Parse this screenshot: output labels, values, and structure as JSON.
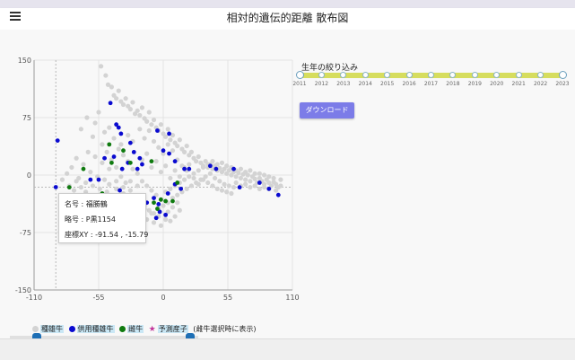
{
  "header": {
    "title": "相対的遺伝的距離 散布図"
  },
  "tooltip": {
    "name_line": "名号 : 福勝鶴",
    "code_line": "略号 : P黒1154",
    "coord_line": "座標XY : -91.54 , -15.79"
  },
  "filter": {
    "label": "生年の絞り込み",
    "years": [
      "2011",
      "2012",
      "2013",
      "2014",
      "2015",
      "2016",
      "2017",
      "2018",
      "2019",
      "2020",
      "2021",
      "2022",
      "2023"
    ],
    "selected_range": [
      "2011",
      "2023"
    ]
  },
  "download": {
    "label": "ダウンロード"
  },
  "legend": {
    "items": [
      {
        "label": "種雄牛",
        "marker": "dot",
        "color": "#d3d3d3"
      },
      {
        "label": "供用種雄牛",
        "marker": "dot",
        "color": "#0a0ad0"
      },
      {
        "label": "雌牛",
        "marker": "dot",
        "color": "#0f7a0f"
      },
      {
        "label": "予測産子",
        "marker": "star",
        "color": "#c2359b"
      }
    ],
    "note": "(雌牛選択時に表示)"
  },
  "colors": {
    "gray": "#d3d3d3",
    "blue": "#0a0ad0",
    "green": "#0f7a0f",
    "track": "#d6dd5e",
    "button": "#7c7ce8"
  },
  "chart_data": {
    "type": "scatter",
    "xlim": [
      -110,
      110
    ],
    "ylim": [
      -150,
      150
    ],
    "xticks": [
      "-110",
      "-55",
      "0",
      "55",
      "110"
    ],
    "yticks": [
      "150",
      "75",
      "0",
      "-75",
      "-150"
    ],
    "grid": true,
    "series": [
      {
        "name": "種雄牛",
        "color": "#d3d3d3",
        "points": [
          [
            -53,
            142
          ],
          [
            -49,
            130
          ],
          [
            -47,
            118
          ],
          [
            -44,
            115
          ],
          [
            -42,
            104
          ],
          [
            -40,
            100
          ],
          [
            -38,
            110
          ],
          [
            -36,
            96
          ],
          [
            -34,
            92
          ],
          [
            -32,
            100
          ],
          [
            -30,
            90
          ],
          [
            -28,
            86
          ],
          [
            -26,
            95
          ],
          [
            -24,
            80
          ],
          [
            -22,
            84
          ],
          [
            -20,
            78
          ],
          [
            -18,
            88
          ],
          [
            -16,
            74
          ],
          [
            -14,
            70
          ],
          [
            -12,
            82
          ],
          [
            -10,
            66
          ],
          [
            -8,
            72
          ],
          [
            -6,
            62
          ],
          [
            -4,
            58
          ],
          [
            -2,
            66
          ],
          [
            0,
            54
          ],
          [
            2,
            50
          ],
          [
            4,
            60
          ],
          [
            6,
            46
          ],
          [
            8,
            52
          ],
          [
            10,
            42
          ],
          [
            12,
            38
          ],
          [
            14,
            46
          ],
          [
            16,
            34
          ],
          [
            18,
            30
          ],
          [
            20,
            38
          ],
          [
            22,
            26
          ],
          [
            24,
            30
          ],
          [
            26,
            22
          ],
          [
            28,
            18
          ],
          [
            30,
            24
          ],
          [
            32,
            16
          ],
          [
            34,
            12
          ],
          [
            36,
            18
          ],
          [
            38,
            10
          ],
          [
            40,
            14
          ],
          [
            42,
            8
          ],
          [
            44,
            12
          ],
          [
            46,
            6
          ],
          [
            48,
            9
          ],
          [
            50,
            4
          ],
          [
            52,
            8
          ],
          [
            54,
            2
          ],
          [
            56,
            6
          ],
          [
            58,
            0
          ],
          [
            60,
            4
          ],
          [
            62,
            -2
          ],
          [
            64,
            3
          ],
          [
            66,
            -4
          ],
          [
            68,
            1
          ],
          [
            70,
            -6
          ],
          [
            72,
            0
          ],
          [
            74,
            -8
          ],
          [
            76,
            -2
          ],
          [
            78,
            -5
          ],
          [
            80,
            -10
          ],
          [
            82,
            -4
          ],
          [
            84,
            -8
          ],
          [
            86,
            -12
          ],
          [
            88,
            -6
          ],
          [
            90,
            -10
          ],
          [
            92,
            -14
          ],
          [
            94,
            -9
          ],
          [
            96,
            -12
          ],
          [
            98,
            -16
          ],
          [
            100,
            -14
          ],
          [
            -70,
            60
          ],
          [
            -65,
            75
          ],
          [
            -60,
            50
          ],
          [
            -58,
            68
          ],
          [
            -55,
            82
          ],
          [
            -52,
            40
          ],
          [
            -50,
            56
          ],
          [
            -48,
            30
          ],
          [
            -46,
            62
          ],
          [
            -44,
            20
          ],
          [
            -42,
            48
          ],
          [
            -40,
            10
          ],
          [
            -38,
            34
          ],
          [
            -36,
            -2
          ],
          [
            -34,
            26
          ],
          [
            -32,
            -10
          ],
          [
            -30,
            18
          ],
          [
            -28,
            -20
          ],
          [
            -26,
            8
          ],
          [
            -24,
            -28
          ],
          [
            -22,
            2
          ],
          [
            -20,
            -34
          ],
          [
            -18,
            -8
          ],
          [
            -16,
            -40
          ],
          [
            -14,
            -14
          ],
          [
            -12,
            -46
          ],
          [
            -10,
            -20
          ],
          [
            -8,
            -50
          ],
          [
            -6,
            -26
          ],
          [
            -4,
            -44
          ],
          [
            -2,
            -32
          ],
          [
            0,
            -40
          ],
          [
            2,
            -22
          ],
          [
            4,
            -36
          ],
          [
            6,
            -18
          ],
          [
            8,
            -30
          ],
          [
            10,
            -14
          ],
          [
            12,
            -26
          ],
          [
            14,
            -10
          ],
          [
            16,
            -22
          ],
          [
            18,
            -6
          ],
          [
            20,
            -18
          ],
          [
            22,
            -2
          ],
          [
            24,
            -14
          ],
          [
            26,
            2
          ],
          [
            28,
            -10
          ],
          [
            30,
            6
          ],
          [
            32,
            -6
          ],
          [
            34,
            10
          ],
          [
            36,
            -2
          ],
          [
            38,
            14
          ],
          [
            40,
            2
          ],
          [
            42,
            -14
          ],
          [
            44,
            -4
          ],
          [
            46,
            -18
          ],
          [
            48,
            -8
          ],
          [
            50,
            -20
          ],
          [
            52,
            -12
          ],
          [
            54,
            -22
          ],
          [
            56,
            -14
          ],
          [
            58,
            -24
          ],
          [
            60,
            -16
          ],
          [
            -78,
            10
          ],
          [
            -74,
            22
          ],
          [
            -72,
            -4
          ],
          [
            -68,
            14
          ],
          [
            -66,
            -10
          ],
          [
            -62,
            4
          ],
          [
            -60,
            -14
          ],
          [
            -56,
            -2
          ],
          [
            -54,
            -18
          ],
          [
            -50,
            -6
          ],
          [
            -48,
            -22
          ],
          [
            -46,
            -12
          ],
          [
            -44,
            -30
          ],
          [
            -40,
            -18
          ],
          [
            -38,
            -36
          ],
          [
            -34,
            -24
          ],
          [
            -32,
            -42
          ],
          [
            -28,
            -30
          ],
          [
            -26,
            -46
          ],
          [
            -22,
            -38
          ],
          [
            -20,
            -52
          ],
          [
            -16,
            -44
          ],
          [
            -14,
            -58
          ],
          [
            -10,
            -50
          ],
          [
            -8,
            -62
          ],
          [
            -4,
            -54
          ],
          [
            -2,
            -66
          ],
          [
            2,
            -58
          ],
          [
            4,
            -48
          ],
          [
            6,
            -60
          ],
          [
            8,
            -42
          ],
          [
            10,
            -54
          ],
          [
            12,
            -36
          ],
          [
            14,
            -46
          ],
          [
            -36,
            40
          ],
          [
            -30,
            52
          ],
          [
            -26,
            44
          ],
          [
            -20,
            60
          ],
          [
            -16,
            48
          ],
          [
            -12,
            58
          ],
          [
            -8,
            44
          ],
          [
            -4,
            36
          ],
          [
            0,
            28
          ],
          [
            4,
            40
          ],
          [
            8,
            32
          ],
          [
            12,
            20
          ],
          [
            16,
            12
          ],
          [
            20,
            6
          ],
          [
            -60,
            -30
          ],
          [
            -56,
            -40
          ],
          [
            -52,
            -34
          ],
          [
            -66,
            -22
          ],
          [
            -70,
            -16
          ],
          [
            -74,
            -8
          ],
          [
            -82,
            2
          ],
          [
            -86,
            -6
          ],
          [
            -80,
            -14
          ],
          [
            -76,
            -20
          ],
          [
            -64,
            30
          ],
          [
            -58,
            24
          ],
          [
            -52,
            16
          ],
          [
            -46,
            8
          ],
          [
            -40,
            -8
          ],
          [
            -34,
            -16
          ],
          [
            -28,
            -8
          ],
          [
            -22,
            -14
          ],
          [
            -18,
            20
          ],
          [
            -14,
            28
          ],
          [
            -10,
            10
          ],
          [
            -6,
            18
          ],
          [
            -2,
            4
          ],
          [
            2,
            12
          ],
          [
            6,
            -4
          ],
          [
            10,
            6
          ],
          [
            14,
            -2
          ],
          [
            18,
            10
          ],
          [
            22,
            14
          ],
          [
            26,
            -4
          ],
          [
            30,
            -12
          ],
          [
            34,
            -6
          ],
          [
            38,
            -10
          ],
          [
            42,
            18
          ],
          [
            46,
            14
          ],
          [
            50,
            16
          ],
          [
            54,
            12
          ],
          [
            58,
            10
          ],
          [
            62,
            6
          ],
          [
            66,
            8
          ],
          [
            70,
            4
          ],
          [
            74,
            6
          ],
          [
            78,
            2
          ],
          [
            82,
            2
          ],
          [
            86,
            0
          ],
          [
            90,
            -2
          ],
          [
            94,
            -4
          ],
          [
            62,
            -10
          ],
          [
            66,
            -14
          ],
          [
            70,
            -12
          ],
          [
            74,
            -16
          ],
          [
            78,
            -14
          ],
          [
            82,
            -18
          ],
          [
            86,
            -16
          ],
          [
            90,
            -18
          ],
          [
            96,
            -20
          ],
          [
            100,
            -6
          ]
        ]
      },
      {
        "name": "供用種雄牛",
        "color": "#0a0ad0",
        "points": [
          [
            -91.5,
            -15.8
          ],
          [
            -90,
            45
          ],
          [
            -45,
            94
          ],
          [
            -40,
            66
          ],
          [
            -38,
            62
          ],
          [
            -36,
            54
          ],
          [
            -28,
            42
          ],
          [
            -25,
            30
          ],
          [
            -20,
            22
          ],
          [
            -18,
            14
          ],
          [
            -30,
            16
          ],
          [
            -42,
            24
          ],
          [
            -62,
            -6
          ],
          [
            -55,
            -6
          ],
          [
            -50,
            22
          ],
          [
            -35,
            8
          ],
          [
            -22,
            8
          ],
          [
            -5,
            58
          ],
          [
            5,
            54
          ],
          [
            0,
            32
          ],
          [
            5,
            28
          ],
          [
            10,
            18
          ],
          [
            18,
            8
          ],
          [
            22,
            8
          ],
          [
            10,
            -12
          ],
          [
            15,
            -18
          ],
          [
            4,
            -24
          ],
          [
            -8,
            -30
          ],
          [
            -14,
            -36
          ],
          [
            -4,
            -38
          ],
          [
            -3,
            -48
          ],
          [
            2,
            -52
          ],
          [
            -6,
            -56
          ],
          [
            -20,
            -56
          ],
          [
            -34,
            -62
          ],
          [
            40,
            12
          ],
          [
            45,
            8
          ],
          [
            60,
            8
          ],
          [
            65,
            -16
          ],
          [
            82,
            -10
          ],
          [
            90,
            -18
          ],
          [
            98,
            -26
          ],
          [
            -37,
            -20
          ],
          [
            -28,
            -30
          ],
          [
            -55,
            -36
          ],
          [
            -50,
            -40
          ]
        ]
      },
      {
        "name": "雌牛",
        "color": "#0f7a0f",
        "points": [
          [
            -68,
            8
          ],
          [
            -46,
            40
          ],
          [
            -34,
            32
          ],
          [
            -44,
            16
          ],
          [
            -28,
            16
          ],
          [
            -10,
            18
          ],
          [
            -8,
            -36
          ],
          [
            -5,
            -44
          ],
          [
            -2,
            -32
          ],
          [
            2,
            -34
          ],
          [
            8,
            -34
          ],
          [
            12,
            -10
          ],
          [
            -80,
            -16
          ],
          [
            -70,
            -30
          ],
          [
            -52,
            -24
          ],
          [
            -47,
            -30
          ]
        ]
      }
    ]
  }
}
